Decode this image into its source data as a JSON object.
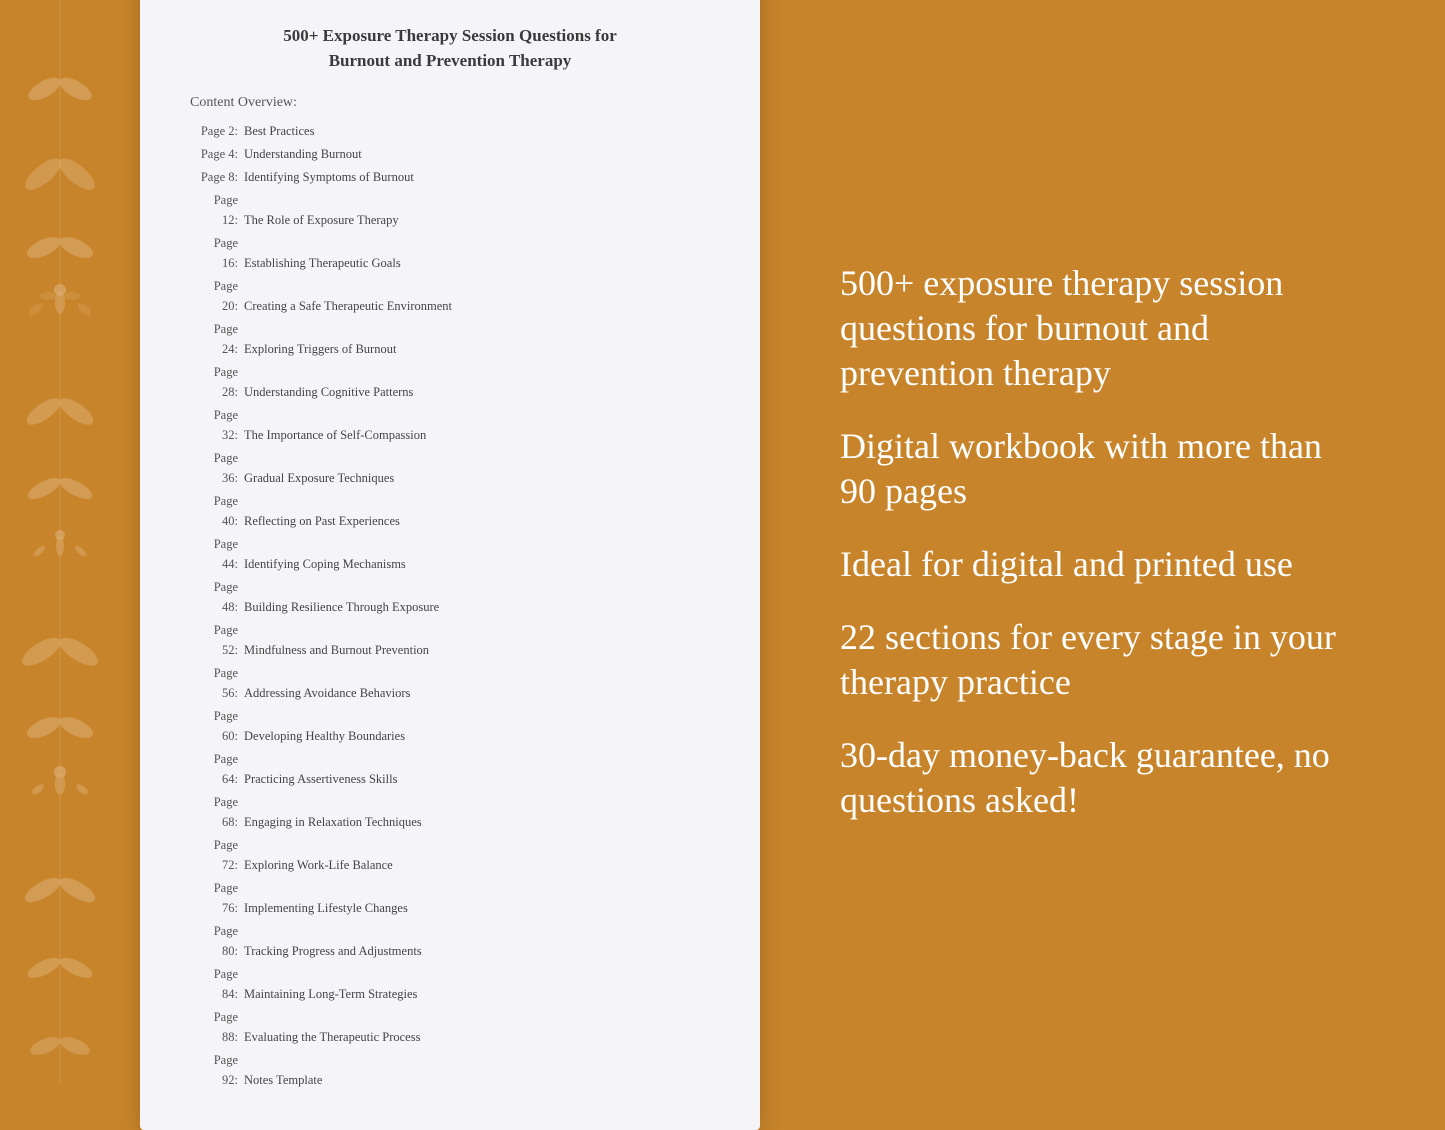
{
  "background": {
    "color": "#C8842A"
  },
  "document": {
    "title_line1": "500+ Exposure Therapy Session Questions for",
    "title_line2": "Burnout and Prevention Therapy",
    "content_overview_label": "Content Overview:",
    "toc": [
      {
        "page": "Page  2:",
        "title": "Best Practices"
      },
      {
        "page": "Page  4:",
        "title": "Understanding Burnout"
      },
      {
        "page": "Page  8:",
        "title": "Identifying Symptoms of Burnout"
      },
      {
        "page": "Page 12:",
        "title": "The Role of Exposure Therapy"
      },
      {
        "page": "Page 16:",
        "title": "Establishing Therapeutic Goals"
      },
      {
        "page": "Page 20:",
        "title": "Creating a Safe Therapeutic Environment"
      },
      {
        "page": "Page 24:",
        "title": "Exploring Triggers of Burnout"
      },
      {
        "page": "Page 28:",
        "title": "Understanding Cognitive Patterns"
      },
      {
        "page": "Page 32:",
        "title": "The Importance of Self-Compassion"
      },
      {
        "page": "Page 36:",
        "title": "Gradual Exposure Techniques"
      },
      {
        "page": "Page 40:",
        "title": "Reflecting on Past Experiences"
      },
      {
        "page": "Page 44:",
        "title": "Identifying Coping Mechanisms"
      },
      {
        "page": "Page 48:",
        "title": "Building Resilience Through Exposure"
      },
      {
        "page": "Page 52:",
        "title": "Mindfulness and Burnout Prevention"
      },
      {
        "page": "Page 56:",
        "title": "Addressing Avoidance Behaviors"
      },
      {
        "page": "Page 60:",
        "title": "Developing Healthy Boundaries"
      },
      {
        "page": "Page 64:",
        "title": "Practicing Assertiveness Skills"
      },
      {
        "page": "Page 68:",
        "title": "Engaging in Relaxation Techniques"
      },
      {
        "page": "Page 72:",
        "title": "Exploring Work-Life Balance"
      },
      {
        "page": "Page 76:",
        "title": "Implementing Lifestyle Changes"
      },
      {
        "page": "Page 80:",
        "title": "Tracking Progress and Adjustments"
      },
      {
        "page": "Page 84:",
        "title": "Maintaining Long-Term Strategies"
      },
      {
        "page": "Page 88:",
        "title": "Evaluating the Therapeutic Process"
      },
      {
        "page": "Page 92:",
        "title": "Notes Template"
      }
    ]
  },
  "features": [
    "500+ exposure therapy session questions for burnout and prevention therapy",
    "Digital workbook with more than 90 pages",
    "Ideal for digital and printed use",
    "22 sections for every stage in your therapy practice",
    "30-day money-back guarantee, no questions asked!"
  ]
}
